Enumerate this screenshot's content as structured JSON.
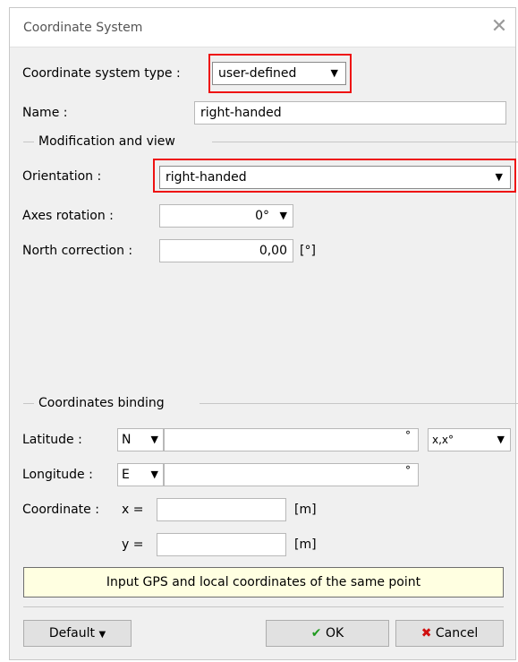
{
  "dialog": {
    "title": "Coordinate System",
    "close_icon": "close-icon"
  },
  "coord_type": {
    "label": "Coordinate system type :",
    "value": "user-defined"
  },
  "name": {
    "label": "Name :",
    "value": "right-handed"
  },
  "modification_group": {
    "title": "Modification and view",
    "orientation": {
      "label": "Orientation :",
      "value": "right-handed"
    },
    "axes_rotation": {
      "label": "Axes rotation :",
      "value": "0°"
    },
    "north_correction": {
      "label": "North correction :",
      "value": "0,00",
      "unit": "[°]"
    }
  },
  "binding_group": {
    "title": "Coordinates binding",
    "latitude": {
      "label": "Latitude :",
      "hemisphere": "N",
      "value": "",
      "degree_symbol": "°",
      "format": "x,x°"
    },
    "longitude": {
      "label": "Longitude :",
      "hemisphere": "E",
      "value": "",
      "degree_symbol": "°"
    },
    "coordinate": {
      "label": "Coordinate :",
      "x_label": "x =",
      "x_value": "",
      "x_unit": "[m]",
      "y_label": "y =",
      "y_value": "",
      "y_unit": "[m]"
    },
    "hint": "Input GPS and local coordinates of the same point"
  },
  "buttons": {
    "default": "Default",
    "ok": "OK",
    "cancel": "Cancel"
  },
  "colors": {
    "highlight": "#e11111",
    "ok_check": "#1f9a1f",
    "cancel_x": "#d01010",
    "hint_bg": "#ffffe1"
  }
}
